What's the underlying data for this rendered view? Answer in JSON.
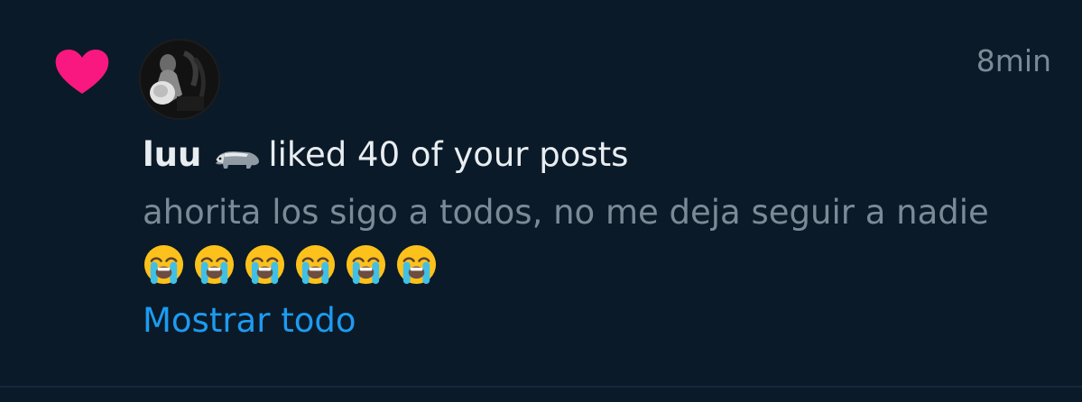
{
  "notification": {
    "timestamp": "8min",
    "username": "luu",
    "username_emoji": "badger-icon",
    "action_text": "liked 40 of your posts",
    "message": "ahorita los sigo a todos, no me deja seguir a nadie",
    "emojis": [
      "loudly-crying-face-icon",
      "loudly-crying-face-icon",
      "loudly-crying-face-icon",
      "loudly-crying-face-icon",
      "loudly-crying-face-icon",
      "loudly-crying-face-icon"
    ],
    "show_all_label": "Mostrar todo",
    "heart_icon": "heart-icon"
  },
  "colors": {
    "background": "#0b1a28",
    "heart": "#f91880",
    "primary_text": "#e8edf1",
    "secondary_text": "#7c8a98",
    "link": "#1d9bf0"
  }
}
